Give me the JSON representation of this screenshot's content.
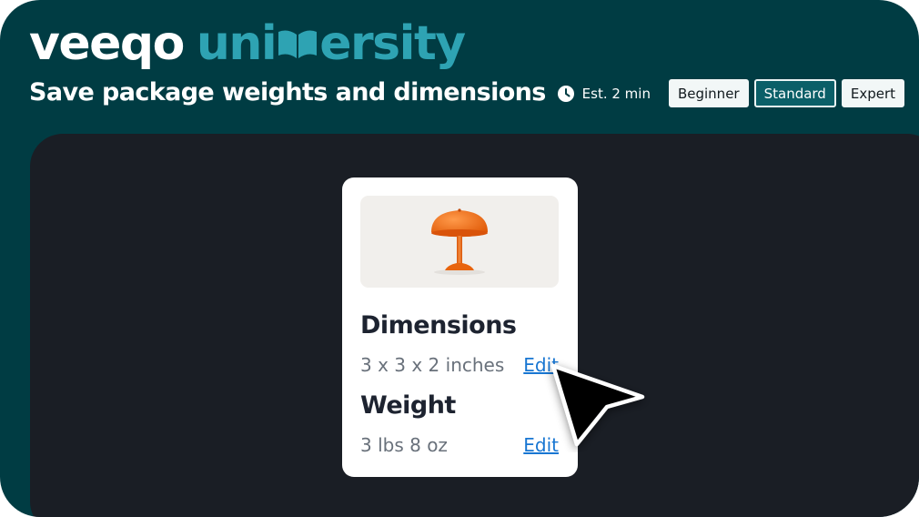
{
  "brand": {
    "veeqo": "veeqo",
    "uni_before": "uni",
    "uni_after": "ersity"
  },
  "title": "Save package weights and dimensions",
  "meta": {
    "estimate": "Est. 2 min",
    "levels": [
      "Beginner",
      "Standard",
      "Expert"
    ],
    "active_level": "Standard"
  },
  "card": {
    "dimensions_heading": "Dimensions",
    "dimensions_value": "3 x 3 x 2 inches",
    "dimensions_edit": "Edit",
    "weight_heading": "Weight",
    "weight_value": "3 lbs 8 oz",
    "weight_edit": "Edit"
  },
  "colors": {
    "header_bg": "#003c43",
    "brand_accent": "#2ea3b3",
    "stage_bg": "#1a1e25",
    "link": "#1876d2",
    "lamp": "#f06a14"
  },
  "icons": [
    "book-icon",
    "clock-icon",
    "lamp-image",
    "mouse-pointer-icon"
  ]
}
